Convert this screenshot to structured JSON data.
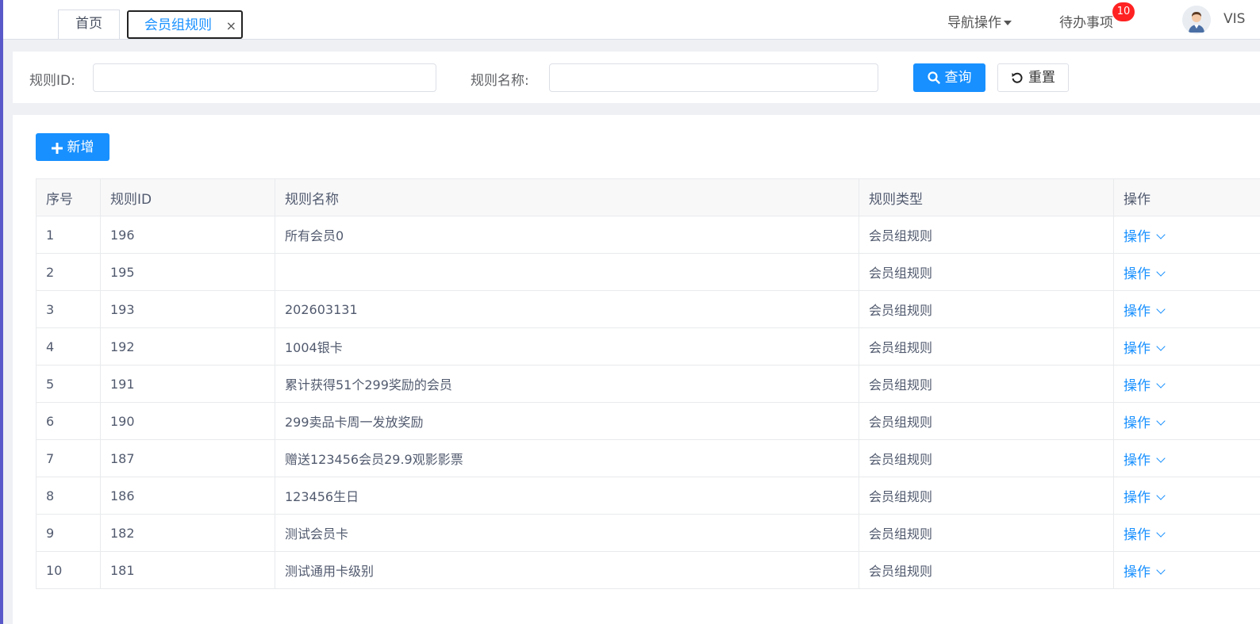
{
  "tabs": [
    {
      "label": "首页"
    },
    {
      "label": "会员组规则",
      "close": "×"
    }
  ],
  "nav": {
    "ops_label": "导航操作",
    "todo_label": "待办事项",
    "todo_badge": "10",
    "user_name": "VIS"
  },
  "search": {
    "rule_id_label": "规则ID:",
    "rule_id_value": "",
    "rule_name_label": "规则名称:",
    "rule_name_value": "",
    "query_button": "查询",
    "reset_button": "重置"
  },
  "toolbar": {
    "add_button": "新增"
  },
  "table": {
    "columns": [
      "序号",
      "规则ID",
      "规则名称",
      "规则类型",
      "操作"
    ],
    "rows": [
      {
        "index": "1",
        "id": "196",
        "name": "所有会员0",
        "type": "会员组规则",
        "op": "操作"
      },
      {
        "index": "2",
        "id": "195",
        "name": "",
        "type": "会员组规则",
        "op": "操作"
      },
      {
        "index": "3",
        "id": "193",
        "name": "202603131",
        "type": "会员组规则",
        "op": "操作"
      },
      {
        "index": "4",
        "id": "192",
        "name": "1004银卡",
        "type": "会员组规则",
        "op": "操作"
      },
      {
        "index": "5",
        "id": "191",
        "name": "累计获得51个299奖励的会员",
        "type": "会员组规则",
        "op": "操作"
      },
      {
        "index": "6",
        "id": "190",
        "name": "299卖品卡周一发放奖励",
        "type": "会员组规则",
        "op": "操作"
      },
      {
        "index": "7",
        "id": "187",
        "name": "赠送123456会员29.9观影影票",
        "type": "会员组规则",
        "op": "操作"
      },
      {
        "index": "8",
        "id": "186",
        "name": "123456生日",
        "type": "会员组规则",
        "op": "操作"
      },
      {
        "index": "9",
        "id": "182",
        "name": "测试会员卡",
        "type": "会员组规则",
        "op": "操作"
      },
      {
        "index": "10",
        "id": "181",
        "name": "测试通用卡级别",
        "type": "会员组规则",
        "op": "操作"
      }
    ]
  },
  "colors": {
    "primary": "#1890ff",
    "badge": "#ff2222",
    "left_accent": "#5a59c9"
  }
}
